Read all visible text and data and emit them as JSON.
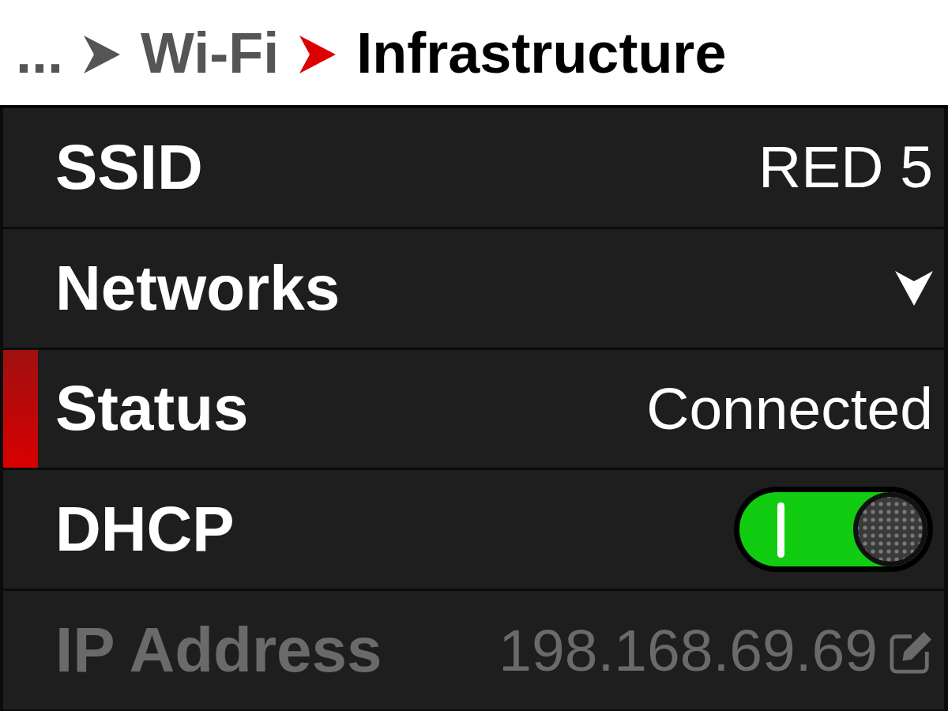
{
  "breadcrumb": [
    {
      "label": "...",
      "current": false
    },
    {
      "label": "Wi-Fi",
      "current": false
    },
    {
      "label": "Infrastructure",
      "current": true
    }
  ],
  "rows": [
    {
      "kind": "value",
      "label": "SSID",
      "value": "RED 5",
      "selected": false,
      "disabled": false
    },
    {
      "kind": "dropdown",
      "label": "Networks",
      "selected": false,
      "disabled": false
    },
    {
      "kind": "value",
      "label": "Status",
      "value": "Connected",
      "selected": true,
      "disabled": false
    },
    {
      "kind": "toggle",
      "label": "DHCP",
      "on": true,
      "selected": false,
      "disabled": false
    },
    {
      "kind": "edit",
      "label": "IP Address",
      "value": "198.168.69.69",
      "selected": false,
      "disabled": true
    }
  ]
}
